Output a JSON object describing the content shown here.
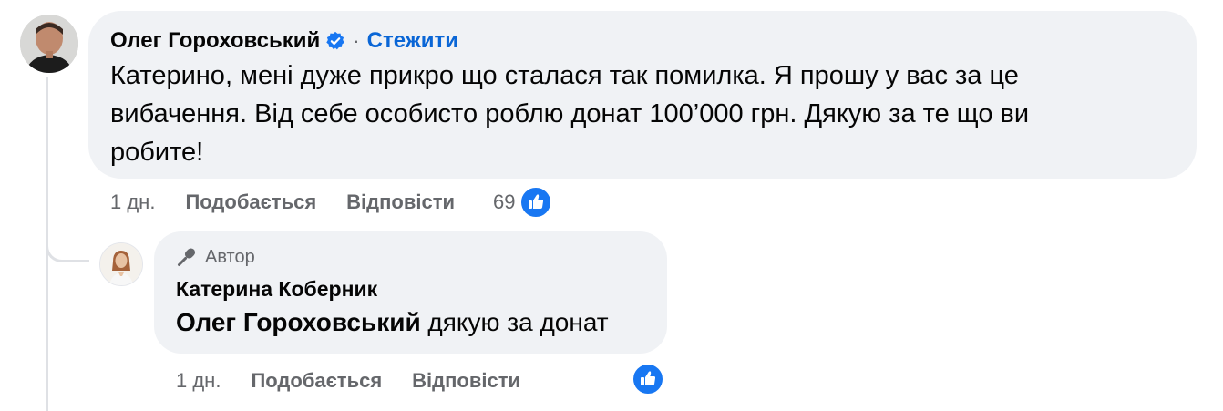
{
  "comment": {
    "author": "Олег Гороховський",
    "separator": "·",
    "follow_label": "Стежити",
    "text_lines": [
      "Катерино, мені дуже прикро що сталася так помилка. Я прошу у вас за це",
      "вибачення. Від себе особисто роблю донат 100’000 грн. Дякую за те що ви",
      "робите!"
    ],
    "time": "1 дн.",
    "like_label": "Подобається",
    "reply_label": "Відповісти",
    "reaction_count": "69"
  },
  "reply": {
    "badge_label": "Автор",
    "author": "Катерина Коберник",
    "mention": "Олег Гороховський",
    "text": " дякую за донат",
    "time": "1 дн.",
    "like_label": "Подобається",
    "reply_label": "Відповісти"
  },
  "colors": {
    "link": "#0a66d6",
    "like": "#1877f2",
    "bubble": "#f0f2f5",
    "meta": "#65676b"
  }
}
